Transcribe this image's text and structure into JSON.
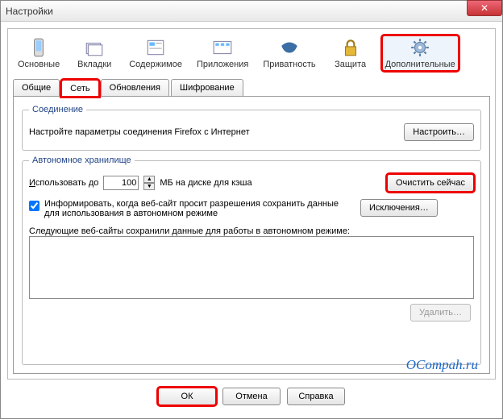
{
  "window": {
    "title": "Настройки"
  },
  "categories": [
    {
      "label": "Основные",
      "icon": "phone"
    },
    {
      "label": "Вкладки",
      "icon": "tabs"
    },
    {
      "label": "Содержимое",
      "icon": "content"
    },
    {
      "label": "Приложения",
      "icon": "apps"
    },
    {
      "label": "Приватность",
      "icon": "mask"
    },
    {
      "label": "Защита",
      "icon": "lock"
    },
    {
      "label": "Дополнительные",
      "icon": "gear",
      "selected": true
    }
  ],
  "tabs": [
    {
      "label": "Общие"
    },
    {
      "label": "Сеть",
      "active": true
    },
    {
      "label": "Обновления"
    },
    {
      "label": "Шифрование"
    }
  ],
  "connection": {
    "legend": "Соединение",
    "text": "Настройте параметры соединения Firefox с Интернет",
    "configure_btn": "Настроить…"
  },
  "storage": {
    "legend": "Автономное хранилище",
    "use_up_to_label": "Использовать до",
    "cache_value": "100",
    "cache_unit_label": "МБ на диске для кэша",
    "clear_now_btn": "Очистить сейчас",
    "inform_checkbox_checked": true,
    "inform_label": "Информировать, когда веб-сайт просит разрешения сохранить данные для использования в автономном режиме",
    "exceptions_btn": "Исключения…",
    "sites_label": "Следующие веб-сайты сохранили данные для работы в автономном режиме:",
    "delete_btn": "Удалить…"
  },
  "buttons": {
    "ok": "ОК",
    "cancel": "Отмена",
    "help": "Справка"
  },
  "watermark": "OCompah.ru"
}
